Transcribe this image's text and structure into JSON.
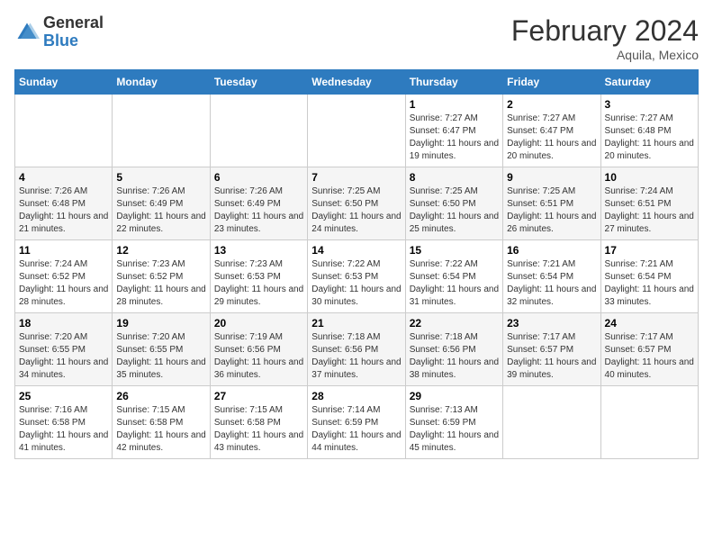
{
  "header": {
    "logo_general": "General",
    "logo_blue": "Blue",
    "title": "February 2024",
    "subtitle": "Aquila, Mexico"
  },
  "days_of_week": [
    "Sunday",
    "Monday",
    "Tuesday",
    "Wednesday",
    "Thursday",
    "Friday",
    "Saturday"
  ],
  "weeks": [
    [
      {
        "day": "",
        "info": ""
      },
      {
        "day": "",
        "info": ""
      },
      {
        "day": "",
        "info": ""
      },
      {
        "day": "",
        "info": ""
      },
      {
        "day": "1",
        "info": "Sunrise: 7:27 AM\nSunset: 6:47 PM\nDaylight: 11 hours and 19 minutes."
      },
      {
        "day": "2",
        "info": "Sunrise: 7:27 AM\nSunset: 6:47 PM\nDaylight: 11 hours and 20 minutes."
      },
      {
        "day": "3",
        "info": "Sunrise: 7:27 AM\nSunset: 6:48 PM\nDaylight: 11 hours and 20 minutes."
      }
    ],
    [
      {
        "day": "4",
        "info": "Sunrise: 7:26 AM\nSunset: 6:48 PM\nDaylight: 11 hours and 21 minutes."
      },
      {
        "day": "5",
        "info": "Sunrise: 7:26 AM\nSunset: 6:49 PM\nDaylight: 11 hours and 22 minutes."
      },
      {
        "day": "6",
        "info": "Sunrise: 7:26 AM\nSunset: 6:49 PM\nDaylight: 11 hours and 23 minutes."
      },
      {
        "day": "7",
        "info": "Sunrise: 7:25 AM\nSunset: 6:50 PM\nDaylight: 11 hours and 24 minutes."
      },
      {
        "day": "8",
        "info": "Sunrise: 7:25 AM\nSunset: 6:50 PM\nDaylight: 11 hours and 25 minutes."
      },
      {
        "day": "9",
        "info": "Sunrise: 7:25 AM\nSunset: 6:51 PM\nDaylight: 11 hours and 26 minutes."
      },
      {
        "day": "10",
        "info": "Sunrise: 7:24 AM\nSunset: 6:51 PM\nDaylight: 11 hours and 27 minutes."
      }
    ],
    [
      {
        "day": "11",
        "info": "Sunrise: 7:24 AM\nSunset: 6:52 PM\nDaylight: 11 hours and 28 minutes."
      },
      {
        "day": "12",
        "info": "Sunrise: 7:23 AM\nSunset: 6:52 PM\nDaylight: 11 hours and 28 minutes."
      },
      {
        "day": "13",
        "info": "Sunrise: 7:23 AM\nSunset: 6:53 PM\nDaylight: 11 hours and 29 minutes."
      },
      {
        "day": "14",
        "info": "Sunrise: 7:22 AM\nSunset: 6:53 PM\nDaylight: 11 hours and 30 minutes."
      },
      {
        "day": "15",
        "info": "Sunrise: 7:22 AM\nSunset: 6:54 PM\nDaylight: 11 hours and 31 minutes."
      },
      {
        "day": "16",
        "info": "Sunrise: 7:21 AM\nSunset: 6:54 PM\nDaylight: 11 hours and 32 minutes."
      },
      {
        "day": "17",
        "info": "Sunrise: 7:21 AM\nSunset: 6:54 PM\nDaylight: 11 hours and 33 minutes."
      }
    ],
    [
      {
        "day": "18",
        "info": "Sunrise: 7:20 AM\nSunset: 6:55 PM\nDaylight: 11 hours and 34 minutes."
      },
      {
        "day": "19",
        "info": "Sunrise: 7:20 AM\nSunset: 6:55 PM\nDaylight: 11 hours and 35 minutes."
      },
      {
        "day": "20",
        "info": "Sunrise: 7:19 AM\nSunset: 6:56 PM\nDaylight: 11 hours and 36 minutes."
      },
      {
        "day": "21",
        "info": "Sunrise: 7:18 AM\nSunset: 6:56 PM\nDaylight: 11 hours and 37 minutes."
      },
      {
        "day": "22",
        "info": "Sunrise: 7:18 AM\nSunset: 6:56 PM\nDaylight: 11 hours and 38 minutes."
      },
      {
        "day": "23",
        "info": "Sunrise: 7:17 AM\nSunset: 6:57 PM\nDaylight: 11 hours and 39 minutes."
      },
      {
        "day": "24",
        "info": "Sunrise: 7:17 AM\nSunset: 6:57 PM\nDaylight: 11 hours and 40 minutes."
      }
    ],
    [
      {
        "day": "25",
        "info": "Sunrise: 7:16 AM\nSunset: 6:58 PM\nDaylight: 11 hours and 41 minutes."
      },
      {
        "day": "26",
        "info": "Sunrise: 7:15 AM\nSunset: 6:58 PM\nDaylight: 11 hours and 42 minutes."
      },
      {
        "day": "27",
        "info": "Sunrise: 7:15 AM\nSunset: 6:58 PM\nDaylight: 11 hours and 43 minutes."
      },
      {
        "day": "28",
        "info": "Sunrise: 7:14 AM\nSunset: 6:59 PM\nDaylight: 11 hours and 44 minutes."
      },
      {
        "day": "29",
        "info": "Sunrise: 7:13 AM\nSunset: 6:59 PM\nDaylight: 11 hours and 45 minutes."
      },
      {
        "day": "",
        "info": ""
      },
      {
        "day": "",
        "info": ""
      }
    ]
  ]
}
